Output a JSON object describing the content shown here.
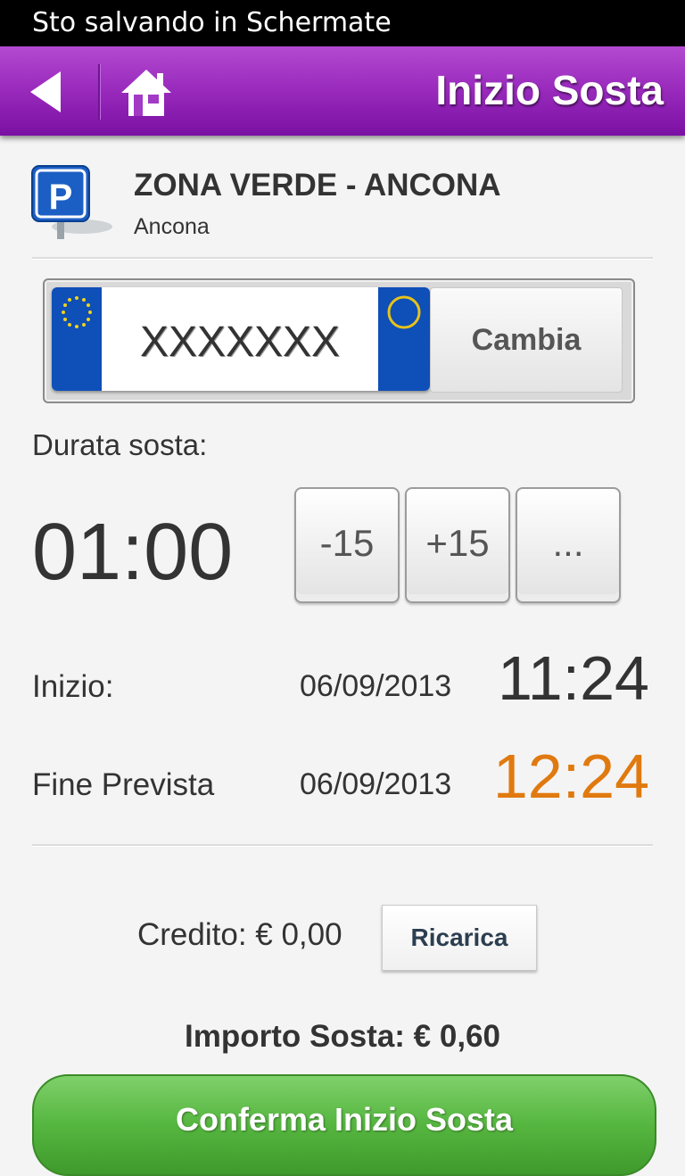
{
  "status_bar": {
    "text": "Sto salvando in Schermate"
  },
  "header": {
    "title": "Inizio Sosta",
    "back_icon": "back-arrow-icon",
    "home_icon": "home-icon",
    "accent": "#9b2cbe"
  },
  "zone": {
    "name": "ZONA VERDE - ANCONA",
    "city": "Ancona",
    "icon": "parking-icon"
  },
  "plate": {
    "number": "XXXXXXX",
    "change_label": "Cambia"
  },
  "duration": {
    "label": "Durata sosta:",
    "value": "01:00",
    "buttons": [
      "-15",
      "+15",
      "..."
    ]
  },
  "start": {
    "label": "Inizio:",
    "date": "06/09/2013",
    "time": "11:24"
  },
  "end": {
    "label": "Fine Prevista",
    "date": "06/09/2013",
    "time": "12:24",
    "color": "#e07a10"
  },
  "credit": {
    "label": "Credito: € 0,00",
    "recharge_label": "Ricarica"
  },
  "amount": {
    "label": "Importo Sosta: € 0,60"
  },
  "confirm": {
    "label": "Conferma Inizio Sosta",
    "color": "#55b63f"
  }
}
